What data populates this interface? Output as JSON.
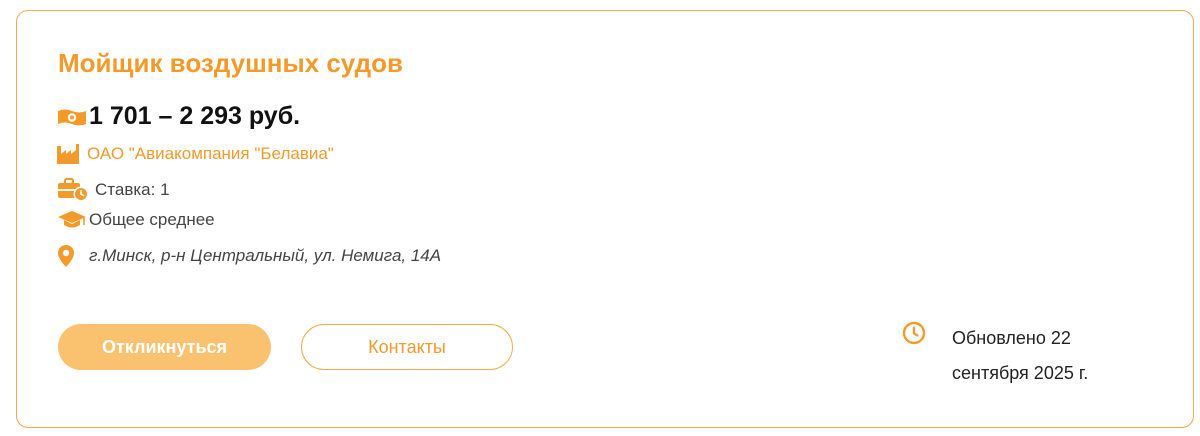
{
  "vacancy": {
    "title": "Мойщик воздушных судов",
    "salary": "1 701 – 2 293 руб.",
    "company": "ОАО \"Авиакомпания \"Белавиа\"",
    "rate": "Ставка: 1",
    "education": "Общее среднее",
    "address": "г.Минск, р-н Центральный, ул. Немига, 14А"
  },
  "actions": {
    "respond_label": "Откликнуться",
    "contacts_label": "Контакты"
  },
  "updated": {
    "text": "Обновлено 22 сентября 2025 г."
  },
  "icons": {
    "salary": "money-icon",
    "company": "factory-icon",
    "rate": "briefcase-clock-icon",
    "education": "graduation-cap-icon",
    "address": "location-pin-icon",
    "updated": "clock-icon"
  },
  "colors": {
    "accent": "#f39a2b",
    "border": "#f5a94a",
    "button_fill": "#fac26f"
  }
}
